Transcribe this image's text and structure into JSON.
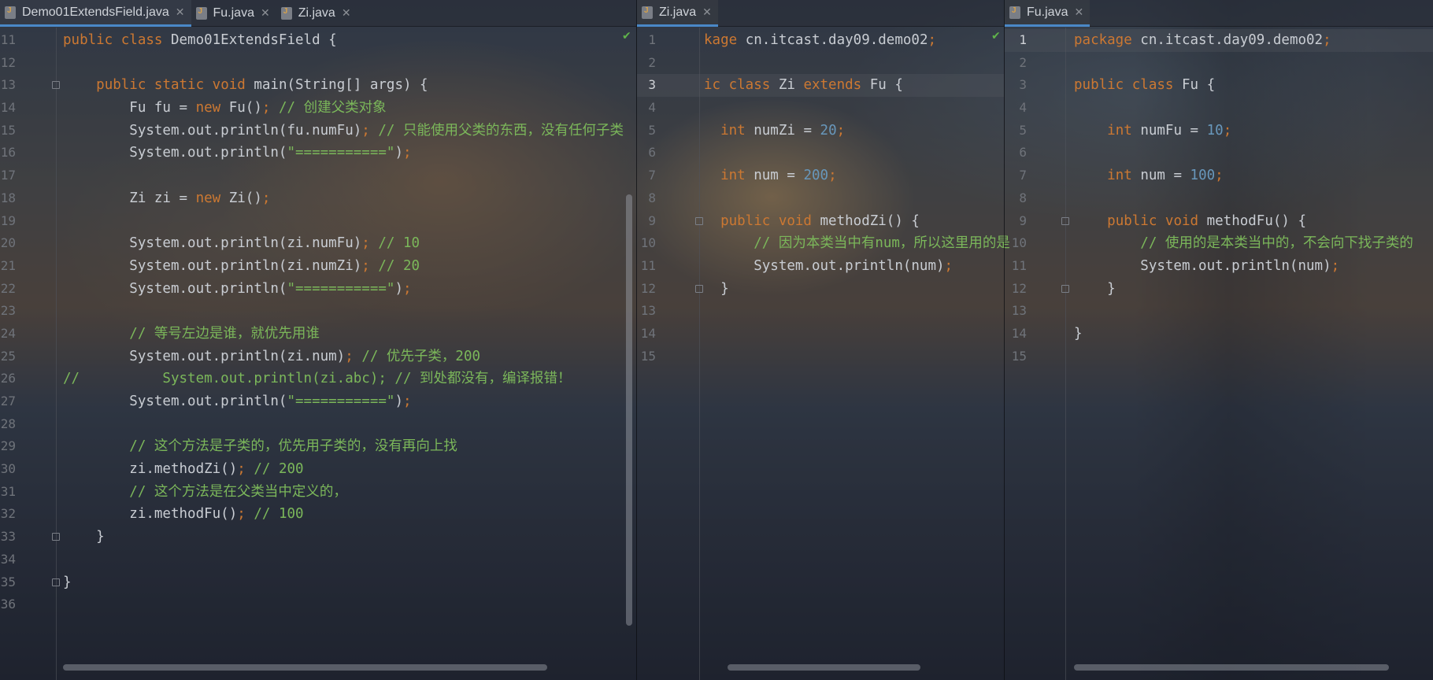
{
  "panes": [
    {
      "tabs": [
        {
          "label": "Demo01ExtendsField.java",
          "active": true
        },
        {
          "label": "Fu.java",
          "active": false
        },
        {
          "label": "Zi.java",
          "active": false
        }
      ]
    },
    {
      "tabs": [
        {
          "label": "Zi.java",
          "active": true
        }
      ]
    },
    {
      "tabs": [
        {
          "label": "Fu.java",
          "active": true
        }
      ]
    }
  ],
  "editor1_lines": [
    {
      "n": "11",
      "tokens": [
        [
          "kw",
          "public class "
        ],
        [
          "",
          "Demo01ExtendsField {"
        ]
      ]
    },
    {
      "n": "12",
      "tokens": []
    },
    {
      "n": "13",
      "tokens": [
        [
          "",
          "    "
        ],
        [
          "kw",
          "public static void "
        ],
        [
          "",
          "main(String[] args) {"
        ]
      ]
    },
    {
      "n": "14",
      "tokens": [
        [
          "",
          "        Fu fu = "
        ],
        [
          "kw",
          "new "
        ],
        [
          "",
          "Fu()"
        ],
        [
          "punc",
          "; "
        ],
        [
          "cm",
          "// 创建父类对象"
        ]
      ]
    },
    {
      "n": "15",
      "tokens": [
        [
          "",
          "        System.out.println(fu.numFu)"
        ],
        [
          "punc",
          "; "
        ],
        [
          "cm",
          "// 只能使用父类的东西，没有任何子类"
        ]
      ]
    },
    {
      "n": "16",
      "tokens": [
        [
          "",
          "        System.out.println("
        ],
        [
          "st",
          "\"===========\""
        ],
        [
          "",
          ")"
        ],
        [
          "punc",
          ";"
        ]
      ]
    },
    {
      "n": "17",
      "tokens": []
    },
    {
      "n": "18",
      "tokens": [
        [
          "",
          "        Zi zi = "
        ],
        [
          "kw",
          "new "
        ],
        [
          "",
          "Zi()"
        ],
        [
          "punc",
          ";"
        ]
      ]
    },
    {
      "n": "19",
      "tokens": []
    },
    {
      "n": "20",
      "tokens": [
        [
          "",
          "        System.out.println(zi.numFu)"
        ],
        [
          "punc",
          "; "
        ],
        [
          "cm",
          "// 10"
        ]
      ]
    },
    {
      "n": "21",
      "tokens": [
        [
          "",
          "        System.out.println(zi.numZi)"
        ],
        [
          "punc",
          "; "
        ],
        [
          "cm",
          "// 20"
        ]
      ]
    },
    {
      "n": "22",
      "tokens": [
        [
          "",
          "        System.out.println("
        ],
        [
          "st",
          "\"===========\""
        ],
        [
          "",
          ")"
        ],
        [
          "punc",
          ";"
        ]
      ]
    },
    {
      "n": "23",
      "tokens": []
    },
    {
      "n": "24",
      "tokens": [
        [
          "",
          "        "
        ],
        [
          "cm",
          "// 等号左边是谁，就优先用谁"
        ]
      ]
    },
    {
      "n": "25",
      "tokens": [
        [
          "",
          "        System.out.println(zi.num)"
        ],
        [
          "punc",
          "; "
        ],
        [
          "cm",
          "// 优先子类，200"
        ]
      ]
    },
    {
      "n": "26",
      "tokens": [
        [
          "cm",
          "//          System.out.println(zi.abc); // 到处都没有，编译报错！"
        ]
      ]
    },
    {
      "n": "27",
      "tokens": [
        [
          "",
          "        System.out.println("
        ],
        [
          "st",
          "\"===========\""
        ],
        [
          "",
          ")"
        ],
        [
          "punc",
          ";"
        ]
      ]
    },
    {
      "n": "28",
      "tokens": []
    },
    {
      "n": "29",
      "tokens": [
        [
          "",
          "        "
        ],
        [
          "cm",
          "// 这个方法是子类的，优先用子类的，没有再向上找"
        ]
      ]
    },
    {
      "n": "30",
      "tokens": [
        [
          "",
          "        zi.methodZi()"
        ],
        [
          "punc",
          "; "
        ],
        [
          "cm",
          "// 200"
        ]
      ]
    },
    {
      "n": "31",
      "tokens": [
        [
          "",
          "        "
        ],
        [
          "cm",
          "// 这个方法是在父类当中定义的，"
        ]
      ]
    },
    {
      "n": "32",
      "tokens": [
        [
          "",
          "        zi.methodFu()"
        ],
        [
          "punc",
          "; "
        ],
        [
          "cm",
          "// 100"
        ]
      ]
    },
    {
      "n": "33",
      "tokens": [
        [
          "",
          "    }"
        ]
      ]
    },
    {
      "n": "34",
      "tokens": []
    },
    {
      "n": "35",
      "tokens": [
        [
          "",
          "}"
        ]
      ]
    },
    {
      "n": "36",
      "tokens": []
    }
  ],
  "editor2_lines": [
    {
      "n": "1",
      "tokens": [
        [
          "kw",
          "kage "
        ],
        [
          "",
          "cn.itcast.day09.demo02"
        ],
        [
          "punc",
          ";"
        ]
      ]
    },
    {
      "n": "2",
      "tokens": []
    },
    {
      "n": "3",
      "tokens": [
        [
          "kw",
          "ic class "
        ],
        [
          "",
          "Zi "
        ],
        [
          "kw",
          "extends "
        ],
        [
          "",
          "Fu {"
        ]
      ]
    },
    {
      "n": "4",
      "tokens": []
    },
    {
      "n": "5",
      "tokens": [
        [
          "",
          "  "
        ],
        [
          "kw",
          "int "
        ],
        [
          "",
          "numZi = "
        ],
        [
          "nm",
          "20"
        ],
        [
          "punc",
          ";"
        ]
      ]
    },
    {
      "n": "6",
      "tokens": []
    },
    {
      "n": "7",
      "tokens": [
        [
          "",
          "  "
        ],
        [
          "kw",
          "int "
        ],
        [
          "",
          "num = "
        ],
        [
          "nm",
          "200"
        ],
        [
          "punc",
          ";"
        ]
      ]
    },
    {
      "n": "8",
      "tokens": []
    },
    {
      "n": "9",
      "tokens": [
        [
          "",
          "  "
        ],
        [
          "kw",
          "public void "
        ],
        [
          "",
          "methodZi() {"
        ]
      ]
    },
    {
      "n": "10",
      "tokens": [
        [
          "",
          "      "
        ],
        [
          "cm",
          "// 因为本类当中有num，所以这里用的是"
        ]
      ]
    },
    {
      "n": "11",
      "tokens": [
        [
          "",
          "      System.out.println(num)"
        ],
        [
          "punc",
          ";"
        ]
      ]
    },
    {
      "n": "12",
      "tokens": [
        [
          "",
          "  }"
        ]
      ]
    },
    {
      "n": "13",
      "tokens": []
    },
    {
      "n": "14",
      "tokens": []
    },
    {
      "n": "15",
      "tokens": []
    }
  ],
  "editor3_lines": [
    {
      "n": "1",
      "tokens": [
        [
          "kw",
          "package "
        ],
        [
          "",
          "cn.itcast.day09.demo02"
        ],
        [
          "punc",
          ";"
        ]
      ]
    },
    {
      "n": "2",
      "tokens": []
    },
    {
      "n": "3",
      "tokens": [
        [
          "kw",
          "public class "
        ],
        [
          "",
          "Fu {"
        ]
      ]
    },
    {
      "n": "4",
      "tokens": []
    },
    {
      "n": "5",
      "tokens": [
        [
          "",
          "    "
        ],
        [
          "kw",
          "int "
        ],
        [
          "",
          "numFu = "
        ],
        [
          "nm",
          "10"
        ],
        [
          "punc",
          ";"
        ]
      ]
    },
    {
      "n": "6",
      "tokens": []
    },
    {
      "n": "7",
      "tokens": [
        [
          "",
          "    "
        ],
        [
          "kw",
          "int "
        ],
        [
          "",
          "num = "
        ],
        [
          "nm",
          "100"
        ],
        [
          "punc",
          ";"
        ]
      ]
    },
    {
      "n": "8",
      "tokens": []
    },
    {
      "n": "9",
      "tokens": [
        [
          "",
          "    "
        ],
        [
          "kw",
          "public void "
        ],
        [
          "",
          "methodFu() {"
        ]
      ]
    },
    {
      "n": "10",
      "tokens": [
        [
          "",
          "        "
        ],
        [
          "cm",
          "// 使用的是本类当中的，不会向下找子类的"
        ]
      ]
    },
    {
      "n": "11",
      "tokens": [
        [
          "",
          "        System.out.println(num)"
        ],
        [
          "punc",
          ";"
        ]
      ]
    },
    {
      "n": "12",
      "tokens": [
        [
          "",
          "    }"
        ]
      ]
    },
    {
      "n": "13",
      "tokens": []
    },
    {
      "n": "14",
      "tokens": [
        [
          "",
          "}"
        ]
      ]
    },
    {
      "n": "15",
      "tokens": []
    }
  ],
  "colors": {
    "keyword": "#cc7832",
    "comment": "#7bb75a",
    "number": "#6897bb",
    "text": "#c9cdd3",
    "active_tab_underline": "#4a88c7",
    "inspection_ok": "#5fb34a"
  },
  "icons": {
    "tab_file": "java-file-icon",
    "tab_close": "close-icon",
    "inspection": "checkmark-icon"
  }
}
